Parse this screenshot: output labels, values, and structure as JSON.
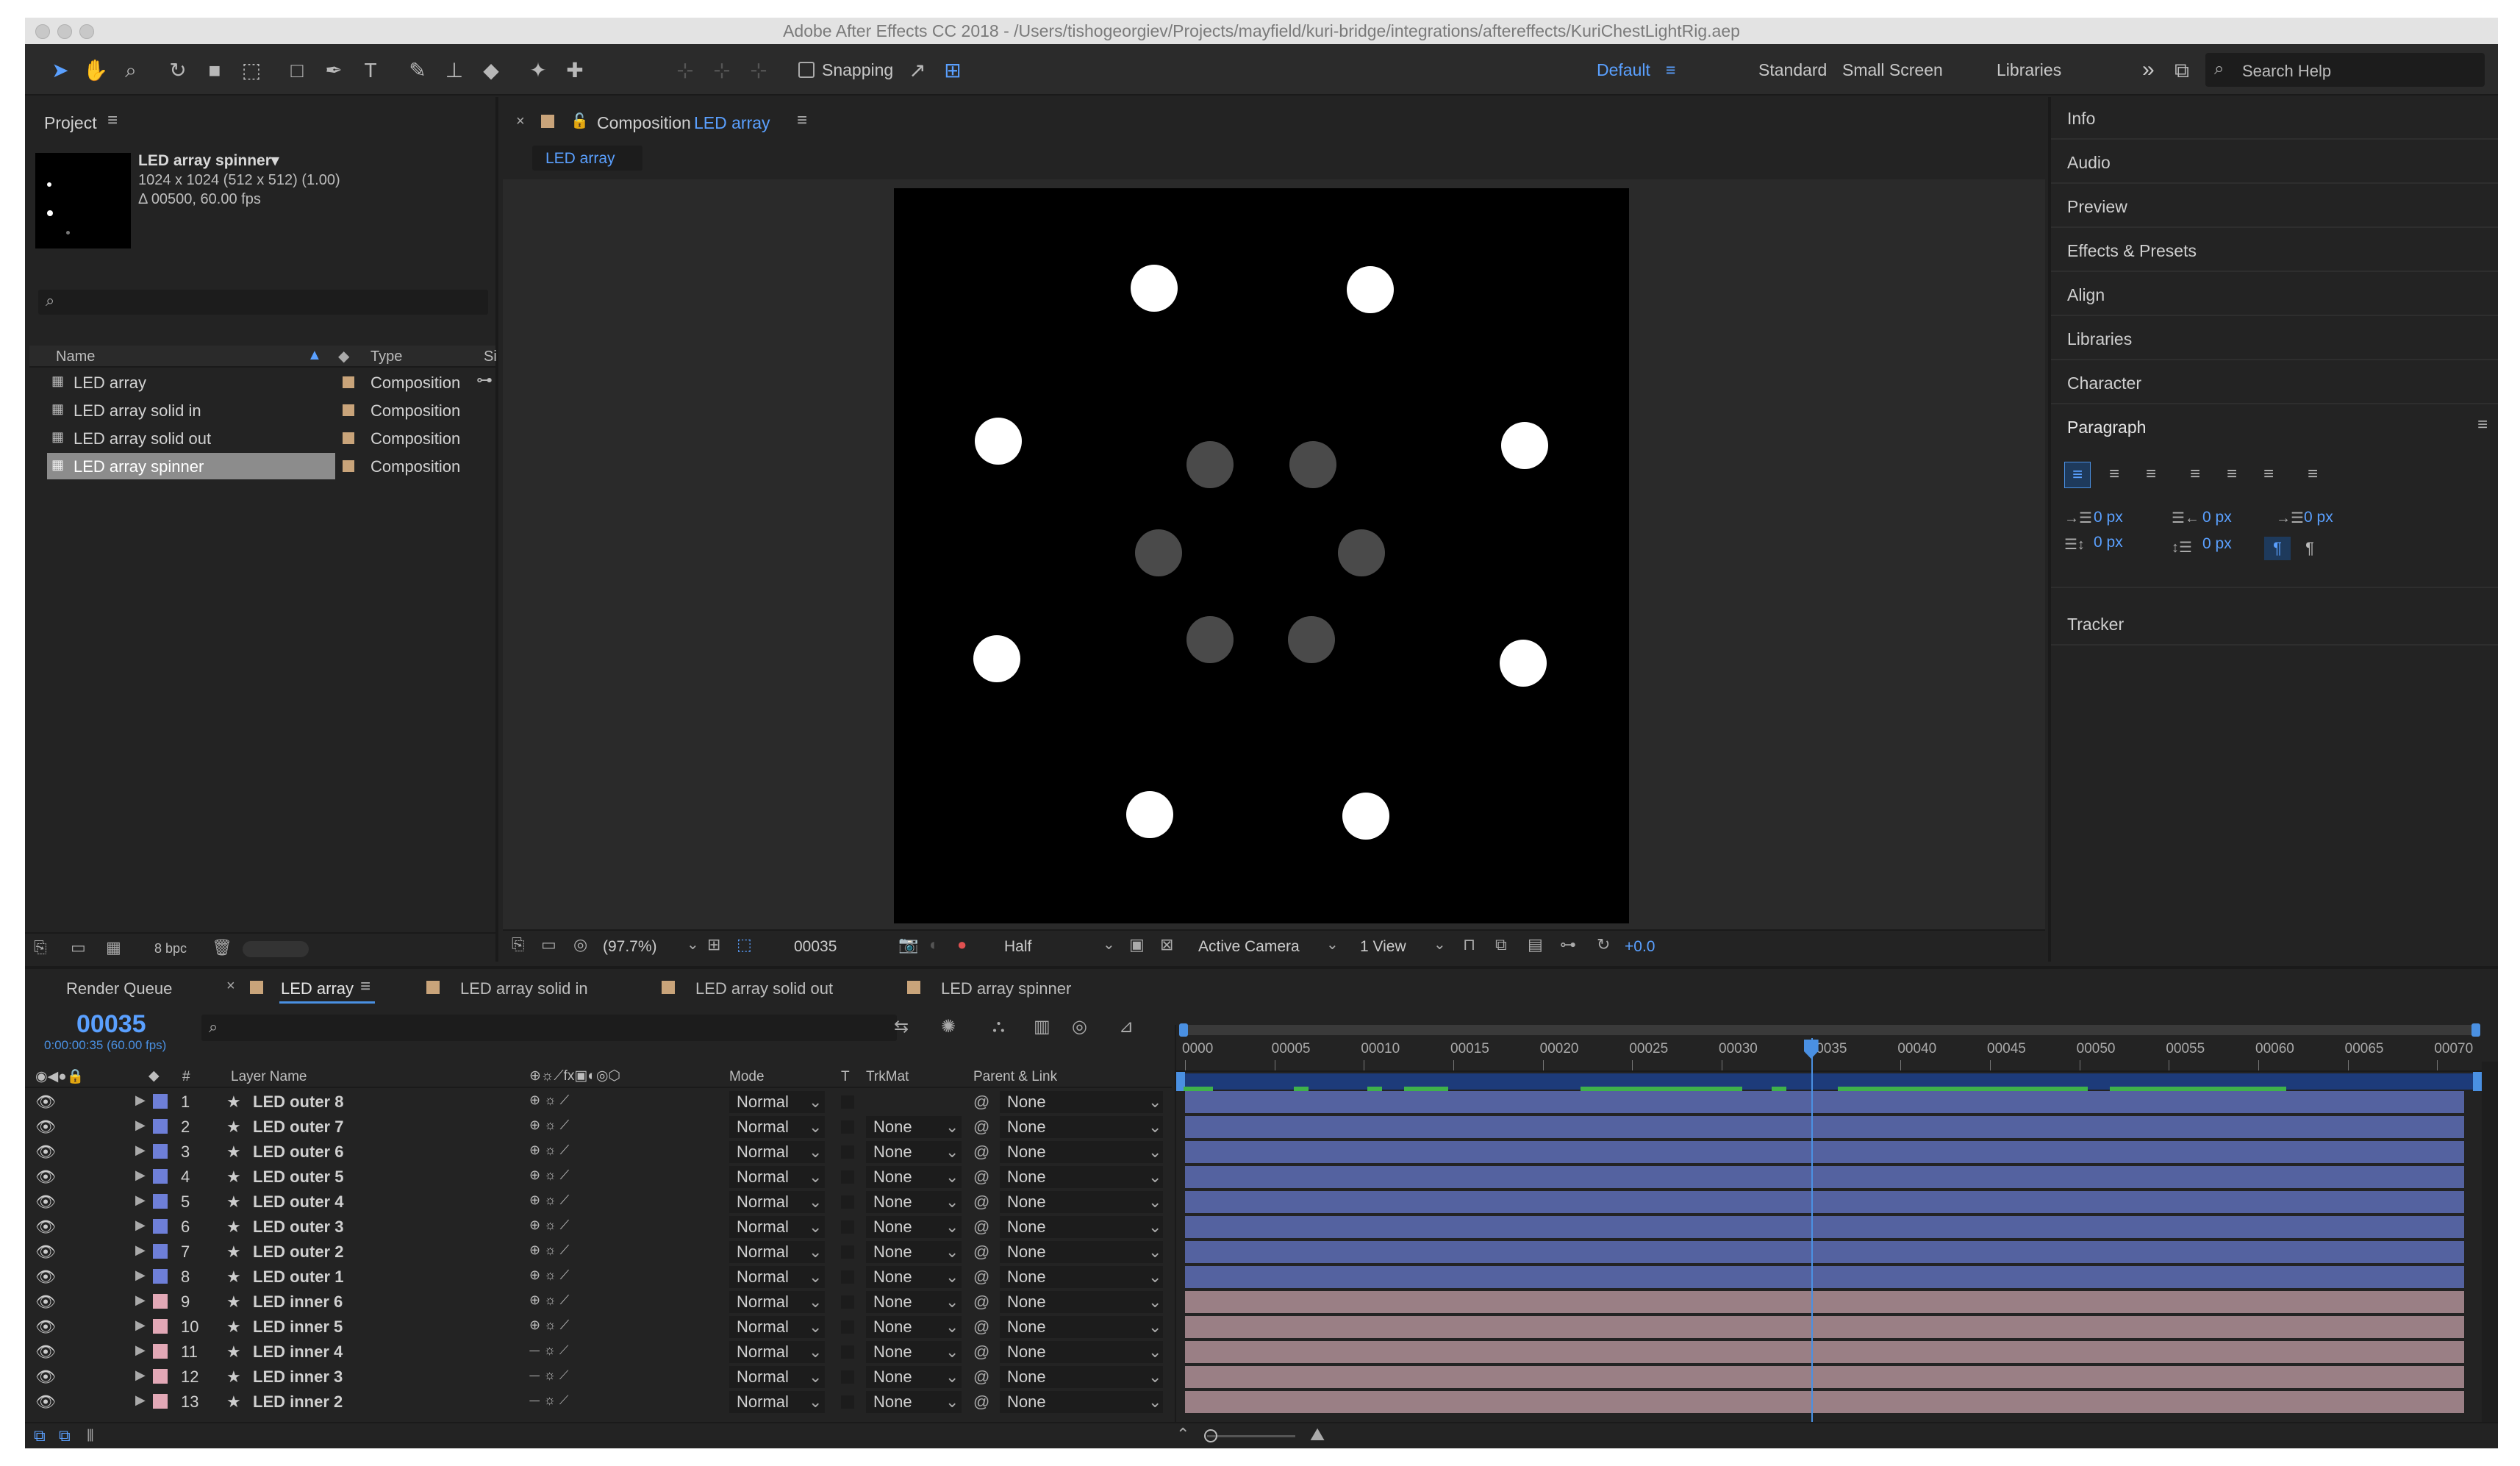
{
  "window": {
    "title": "Adobe After Effects CC 2018 - /Users/tishogeorgiev/Projects/mayfield/kuri-bridge/integrations/aftereffects/KuriChestLightRig.aep"
  },
  "toolbar": {
    "snapping_label": "Snapping",
    "workspaces": [
      "Default",
      "Standard",
      "Small Screen",
      "Libraries"
    ],
    "overflow": "»",
    "search_placeholder": "Search Help"
  },
  "project": {
    "title": "Project",
    "selected_name": "LED array spinner▾",
    "selected_dims": "1024 x 1024  (512 x 512) (1.00)",
    "selected_duration": "Δ 00500, 60.00 fps",
    "columns": {
      "name": "Name",
      "type": "Type",
      "size": "Si"
    },
    "items": [
      {
        "name": "LED array",
        "type": "Composition"
      },
      {
        "name": "LED array solid in",
        "type": "Composition"
      },
      {
        "name": "LED array solid out",
        "type": "Composition"
      },
      {
        "name": "LED array spinner",
        "type": "Composition"
      }
    ],
    "bpc": "8 bpc"
  },
  "composition": {
    "tab_label": "Composition",
    "tab_name": "LED array",
    "breadcrumb": "LED array",
    "zoom": "(97.7%)",
    "timecode": "00035",
    "resolution": "Half",
    "camera": "Active Camera",
    "views": "1 View",
    "exposure": "+0.0"
  },
  "right_panels": [
    "Info",
    "Audio",
    "Preview",
    "Effects & Presets",
    "Align",
    "Libraries",
    "Character"
  ],
  "paragraph": {
    "title": "Paragraph",
    "values": [
      "0 px",
      "0 px",
      "0 px",
      "0 px",
      "0 px"
    ],
    "tracker": "Tracker"
  },
  "timeline_tabs": {
    "render_queue": "Render Queue",
    "tabs": [
      "LED array",
      "LED array solid in",
      "LED array solid out",
      "LED array spinner"
    ]
  },
  "timeline": {
    "current_time": "00035",
    "current_time_sub": "0:00:00:35 (60.00 fps)",
    "headers": {
      "num": "#",
      "layer_name": "Layer Name",
      "mode": "Mode",
      "t": "T",
      "trkmat": "TrkMat",
      "parent": "Parent & Link"
    },
    "ruler": [
      "0000",
      "00005",
      "00010",
      "00015",
      "00020",
      "00025",
      "00030",
      "00035",
      "00040",
      "00045",
      "00050",
      "00055",
      "00060",
      "00065",
      "00070"
    ],
    "playhead_frame": 35,
    "total_frames": 72,
    "layers": [
      {
        "num": "1",
        "name": "LED outer 8",
        "mode": "Normal",
        "trkmat": "",
        "parent": "None",
        "color": "#6e7fd8"
      },
      {
        "num": "2",
        "name": "LED outer 7",
        "mode": "Normal",
        "trkmat": "None",
        "parent": "None",
        "color": "#6e7fd8"
      },
      {
        "num": "3",
        "name": "LED outer 6",
        "mode": "Normal",
        "trkmat": "None",
        "parent": "None",
        "color": "#6e7fd8"
      },
      {
        "num": "4",
        "name": "LED outer 5",
        "mode": "Normal",
        "trkmat": "None",
        "parent": "None",
        "color": "#6e7fd8"
      },
      {
        "num": "5",
        "name": "LED outer 4",
        "mode": "Normal",
        "trkmat": "None",
        "parent": "None",
        "color": "#6e7fd8"
      },
      {
        "num": "6",
        "name": "LED outer 3",
        "mode": "Normal",
        "trkmat": "None",
        "parent": "None",
        "color": "#6e7fd8"
      },
      {
        "num": "7",
        "name": "LED outer 2",
        "mode": "Normal",
        "trkmat": "None",
        "parent": "None",
        "color": "#6e7fd8"
      },
      {
        "num": "8",
        "name": "LED outer 1",
        "mode": "Normal",
        "trkmat": "None",
        "parent": "None",
        "color": "#6e7fd8"
      },
      {
        "num": "9",
        "name": "LED inner 6",
        "mode": "Normal",
        "trkmat": "None",
        "parent": "None",
        "color": "#e2a8b6"
      },
      {
        "num": "10",
        "name": "LED inner 5",
        "mode": "Normal",
        "trkmat": "None",
        "parent": "None",
        "color": "#e2a8b6"
      },
      {
        "num": "11",
        "name": "LED inner 4",
        "mode": "Normal",
        "trkmat": "None",
        "parent": "None",
        "color": "#e2a8b6"
      },
      {
        "num": "12",
        "name": "LED inner 3",
        "mode": "Normal",
        "trkmat": "None",
        "parent": "None",
        "color": "#e2a8b6"
      },
      {
        "num": "13",
        "name": "LED inner 2",
        "mode": "Normal",
        "trkmat": "None",
        "parent": "None",
        "color": "#e2a8b6"
      }
    ]
  },
  "colors": {
    "accent": "#4a90e2",
    "outer_bar": "#5462a0",
    "inner_bar": "#9a7f85",
    "work_area_green": "#3fb24a"
  }
}
